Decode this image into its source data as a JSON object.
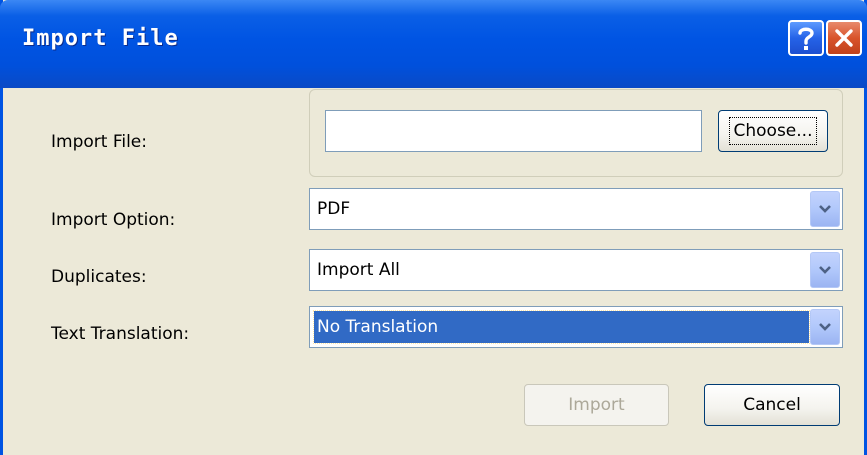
{
  "window": {
    "title": "Import File"
  },
  "labels": {
    "import_file": "Import File:",
    "import_option": "Import Option:",
    "duplicates": "Duplicates:",
    "text_translation": "Text Translation:"
  },
  "file_input": {
    "value": "",
    "placeholder": ""
  },
  "buttons": {
    "choose": "Choose...",
    "import": "Import",
    "cancel": "Cancel"
  },
  "combos": {
    "import_option": "PDF",
    "duplicates": "Import All",
    "text_translation": "No Translation"
  },
  "icons": {
    "help": "help-icon",
    "close": "close-icon",
    "dropdown": "chevron-down-icon"
  },
  "colors": {
    "titlebar": "#0054e3",
    "selection": "#316ac5",
    "dialog_bg": "#ece9d8"
  }
}
